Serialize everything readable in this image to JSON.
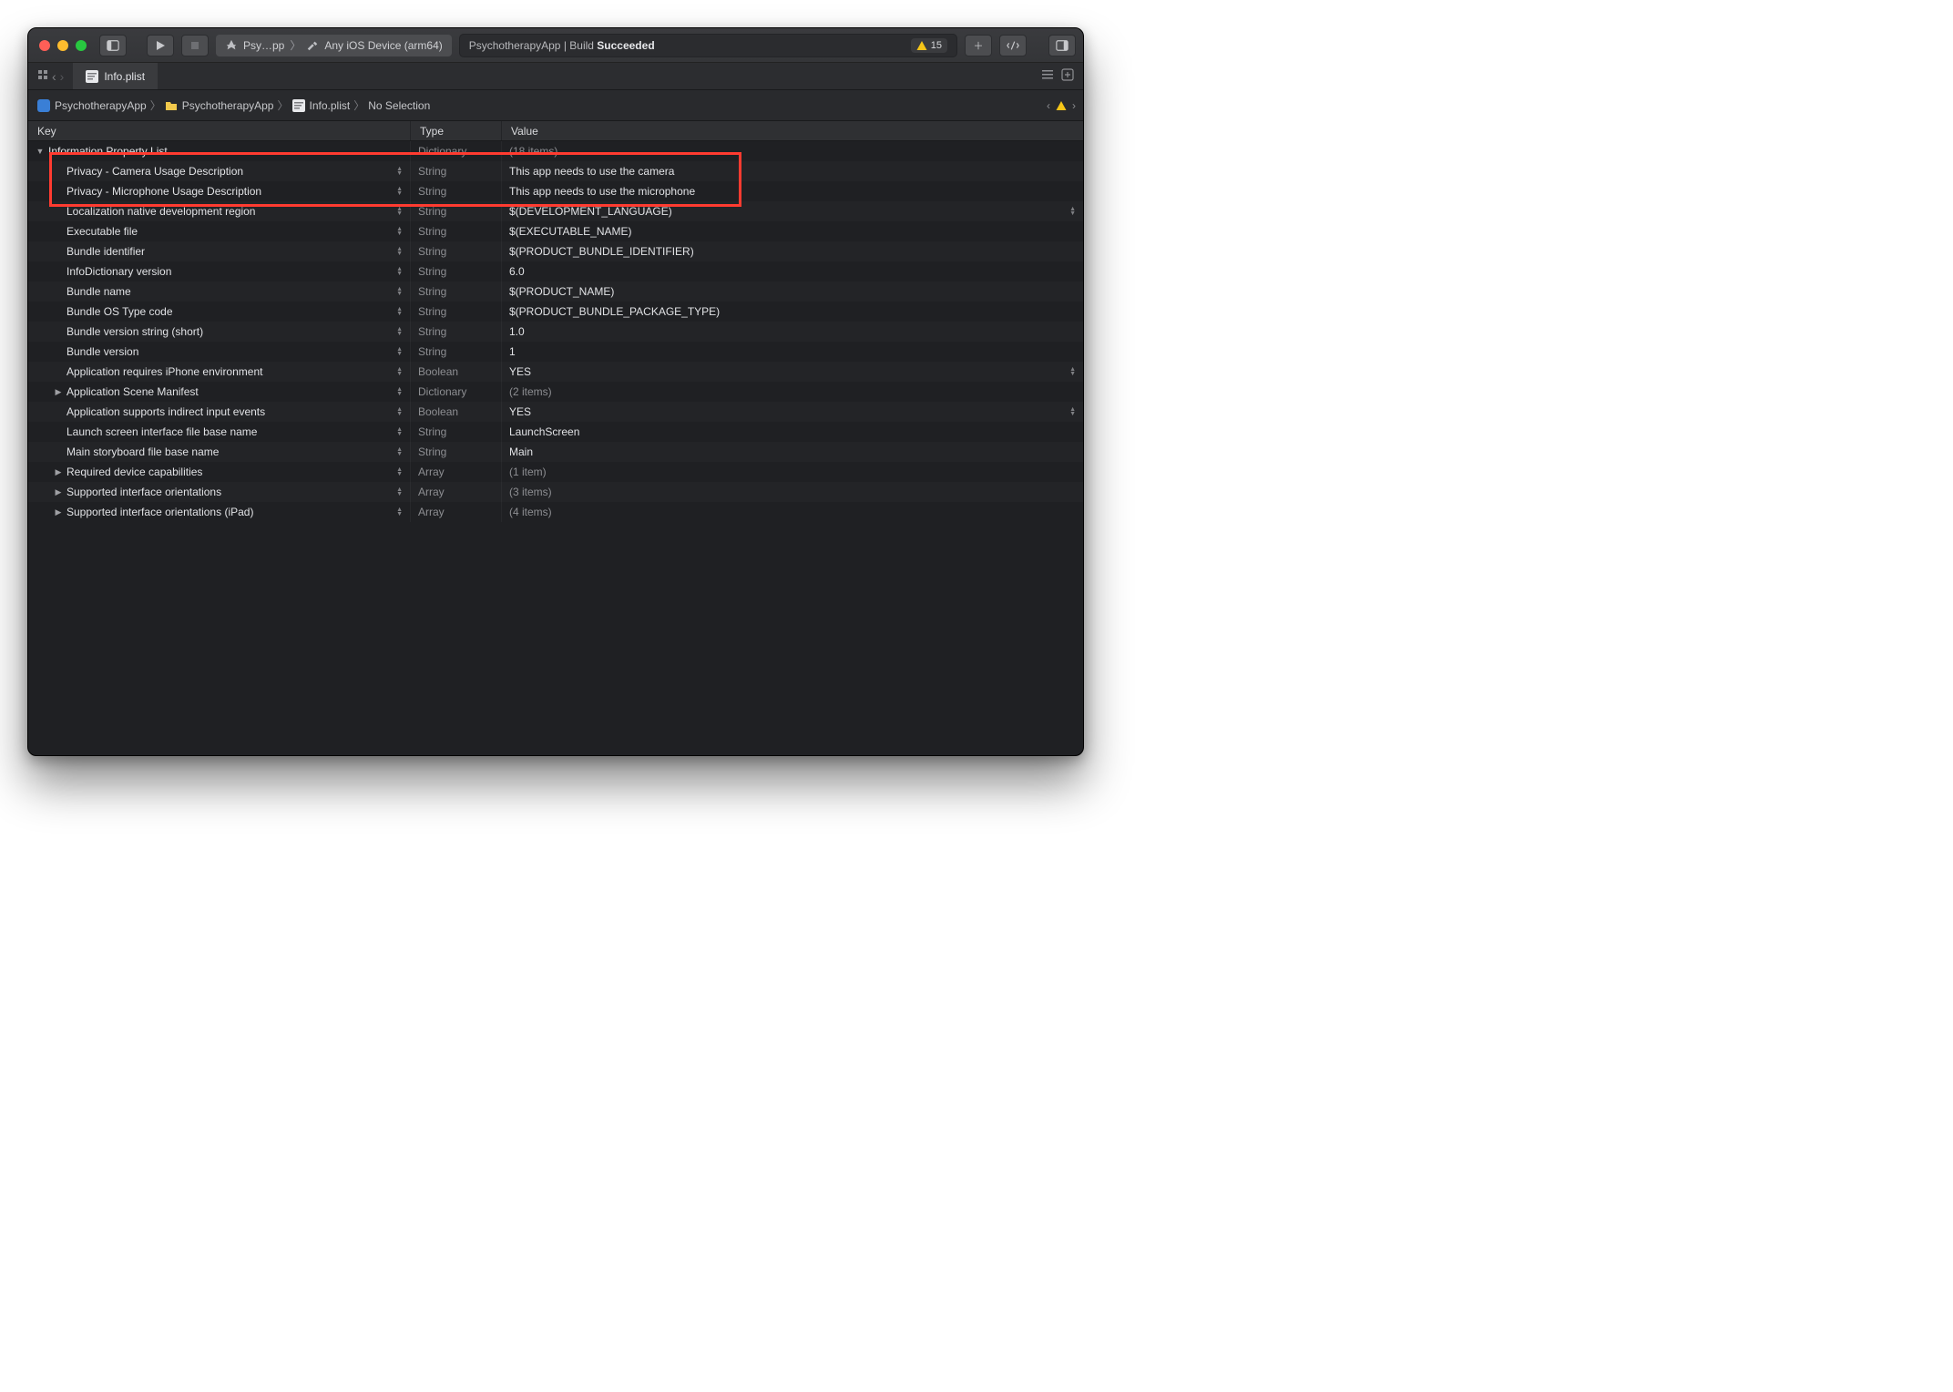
{
  "toolbar": {
    "scheme_app": "Psy…pp",
    "scheme_dest": "Any iOS Device (arm64)",
    "status_prefix": "PsychotherapyApp | Build ",
    "status_result": "Succeeded",
    "warn_count": "15"
  },
  "tab": {
    "filename": "Info.plist"
  },
  "breadcrumb": {
    "items": [
      "PsychotherapyApp",
      "PsychotherapyApp",
      "Info.plist",
      "No Selection"
    ]
  },
  "columns": {
    "key": "Key",
    "type": "Type",
    "value": "Value"
  },
  "rows": [
    {
      "key": "Information Property List",
      "type": "Dictionary",
      "value": "(18 items)",
      "indent": 0,
      "disclosure": "open",
      "stepper": false,
      "highlighted": false
    },
    {
      "key": "Privacy - Camera Usage Description",
      "type": "String",
      "value": "This app needs to use the camera",
      "indent": 1,
      "disclosure": "none",
      "stepper": true,
      "highlighted": true
    },
    {
      "key": "Privacy - Microphone Usage Description",
      "type": "String",
      "value": "This app needs to use the microphone",
      "indent": 1,
      "disclosure": "none",
      "stepper": true,
      "highlighted": true
    },
    {
      "key": "Localization native development region",
      "type": "String",
      "value": "$(DEVELOPMENT_LANGUAGE)",
      "indent": 1,
      "disclosure": "none",
      "stepper": true,
      "vstepper": true,
      "highlighted": false
    },
    {
      "key": "Executable file",
      "type": "String",
      "value": "$(EXECUTABLE_NAME)",
      "indent": 1,
      "disclosure": "none",
      "stepper": true,
      "highlighted": false
    },
    {
      "key": "Bundle identifier",
      "type": "String",
      "value": "$(PRODUCT_BUNDLE_IDENTIFIER)",
      "indent": 1,
      "disclosure": "none",
      "stepper": true,
      "highlighted": false
    },
    {
      "key": "InfoDictionary version",
      "type": "String",
      "value": "6.0",
      "indent": 1,
      "disclosure": "none",
      "stepper": true,
      "highlighted": false
    },
    {
      "key": "Bundle name",
      "type": "String",
      "value": "$(PRODUCT_NAME)",
      "indent": 1,
      "disclosure": "none",
      "stepper": true,
      "highlighted": false
    },
    {
      "key": "Bundle OS Type code",
      "type": "String",
      "value": "$(PRODUCT_BUNDLE_PACKAGE_TYPE)",
      "indent": 1,
      "disclosure": "none",
      "stepper": true,
      "highlighted": false
    },
    {
      "key": "Bundle version string (short)",
      "type": "String",
      "value": "1.0",
      "indent": 1,
      "disclosure": "none",
      "stepper": true,
      "highlighted": false
    },
    {
      "key": "Bundle version",
      "type": "String",
      "value": "1",
      "indent": 1,
      "disclosure": "none",
      "stepper": true,
      "highlighted": false
    },
    {
      "key": "Application requires iPhone environment",
      "type": "Boolean",
      "value": "YES",
      "indent": 1,
      "disclosure": "none",
      "stepper": true,
      "vstepper": true,
      "highlighted": false
    },
    {
      "key": "Application Scene Manifest",
      "type": "Dictionary",
      "value": "(2 items)",
      "indent": 1,
      "disclosure": "closed",
      "stepper": true,
      "highlighted": false
    },
    {
      "key": "Application supports indirect input events",
      "type": "Boolean",
      "value": "YES",
      "indent": 1,
      "disclosure": "none",
      "stepper": true,
      "vstepper": true,
      "highlighted": false
    },
    {
      "key": "Launch screen interface file base name",
      "type": "String",
      "value": "LaunchScreen",
      "indent": 1,
      "disclosure": "none",
      "stepper": true,
      "highlighted": false
    },
    {
      "key": "Main storyboard file base name",
      "type": "String",
      "value": "Main",
      "indent": 1,
      "disclosure": "none",
      "stepper": true,
      "highlighted": false
    },
    {
      "key": "Required device capabilities",
      "type": "Array",
      "value": "(1 item)",
      "indent": 1,
      "disclosure": "closed",
      "stepper": true,
      "highlighted": false
    },
    {
      "key": "Supported interface orientations",
      "type": "Array",
      "value": "(3 items)",
      "indent": 1,
      "disclosure": "closed",
      "stepper": true,
      "highlighted": false
    },
    {
      "key": "Supported interface orientations (iPad)",
      "type": "Array",
      "value": "(4 items)",
      "indent": 1,
      "disclosure": "closed",
      "stepper": true,
      "highlighted": false
    }
  ]
}
